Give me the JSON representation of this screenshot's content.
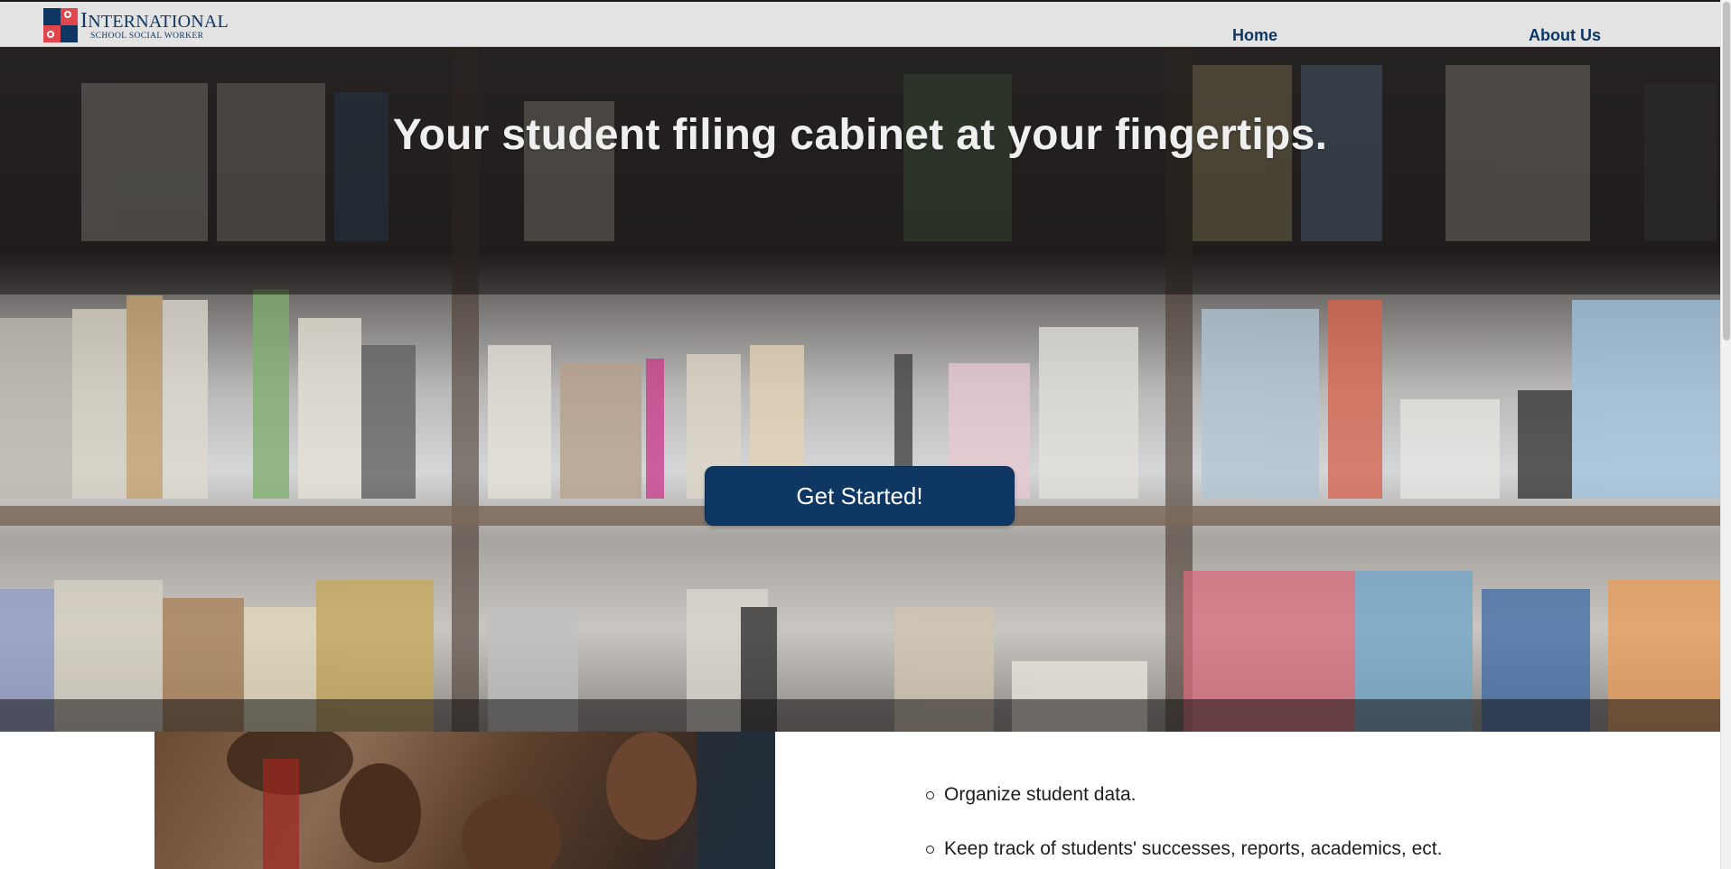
{
  "logo": {
    "line1_cap": "I",
    "line1_rest": "NTERNATIONAL",
    "line2": "SCHOOL SOCIAL WORKER"
  },
  "nav": {
    "home": "Home",
    "about": "About Us"
  },
  "hero": {
    "title": "Your student filing cabinet at your fingertips.",
    "cta_label": "Get Started!"
  },
  "features": [
    "Organize student data.",
    "Keep track of students' successes, reports, academics, ect."
  ],
  "colors": {
    "brand_navy": "#0e3763",
    "brand_red": "#e0474c",
    "navbar_bg": "#e3e3e3"
  }
}
